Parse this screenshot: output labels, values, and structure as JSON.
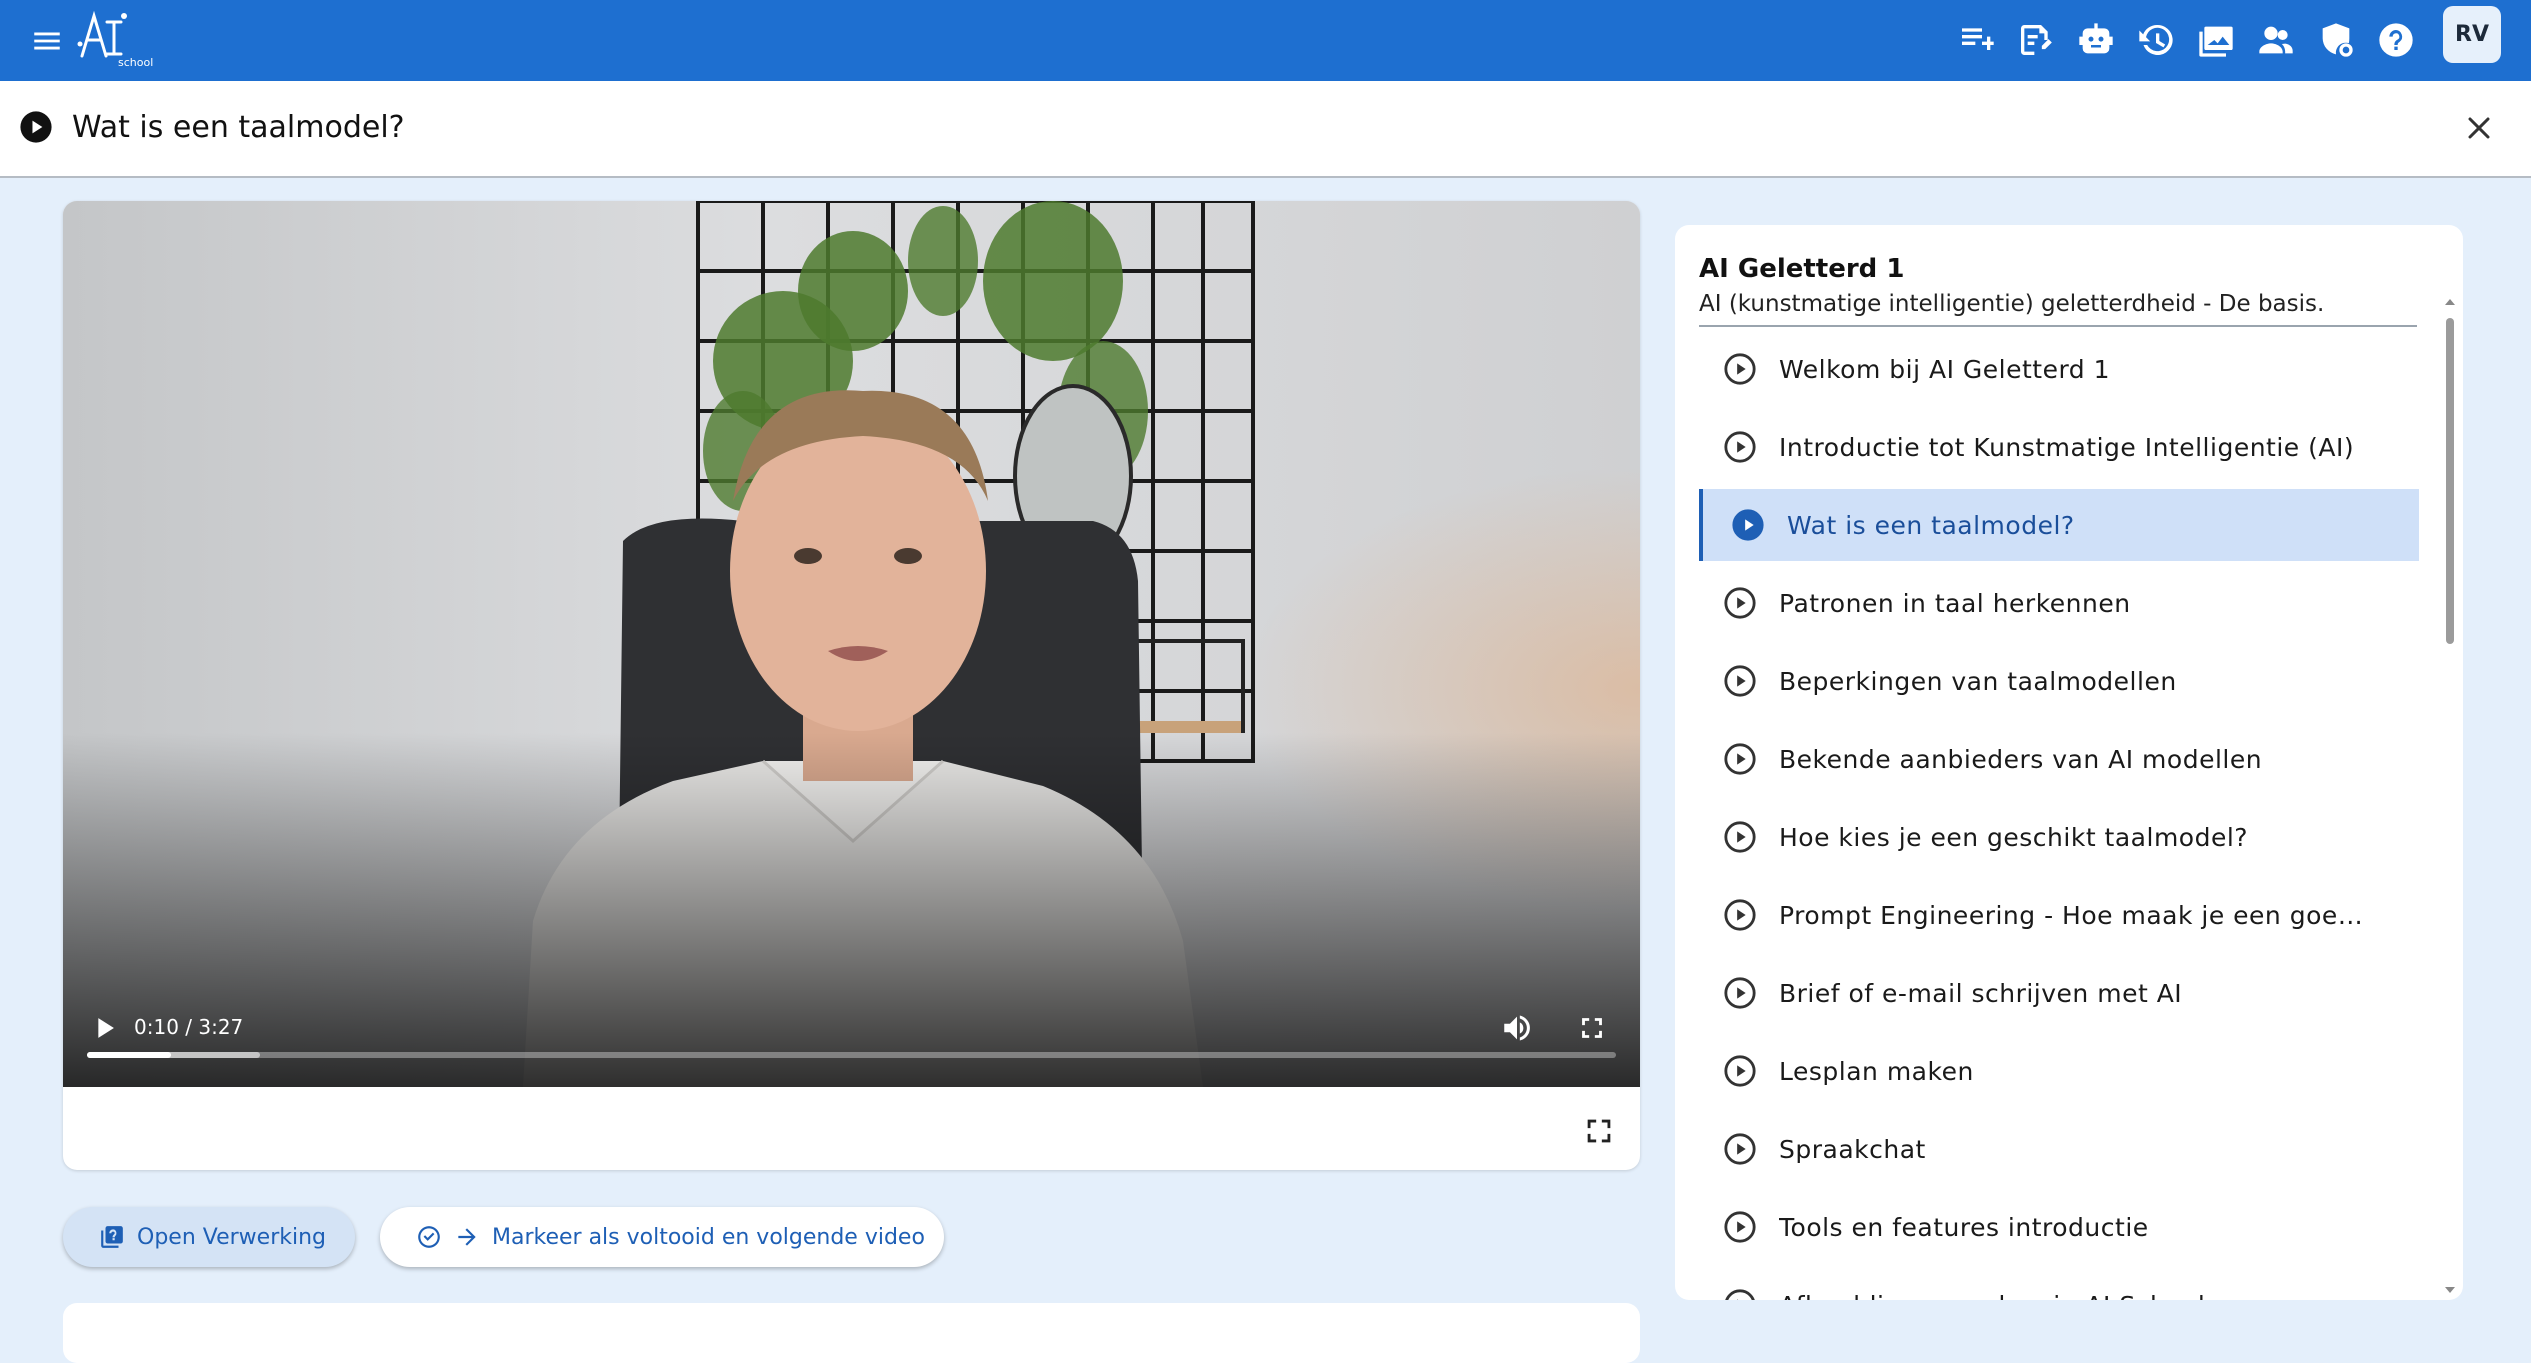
{
  "app": {
    "logo_text": "AI school",
    "avatar_initials": "RV",
    "toolbar_icons": [
      {
        "name": "playlist-add-icon"
      },
      {
        "name": "note-edit-icon"
      },
      {
        "name": "robot-icon"
      },
      {
        "name": "history-icon"
      },
      {
        "name": "image-gallery-icon"
      },
      {
        "name": "people-icon"
      },
      {
        "name": "shield-settings-icon"
      },
      {
        "name": "help-icon"
      }
    ],
    "header_color": "#1e6fd0"
  },
  "page": {
    "title": "Wat is een taalmodel?"
  },
  "video": {
    "time_display": "0:10 / 3:27",
    "progress_fraction": 0.055,
    "buffered_fraction": 0.113
  },
  "actions": {
    "open_label": "Open Verwerking",
    "mark_label": "Markeer als voltooid en volgende video"
  },
  "course": {
    "title": "AI Geletterd 1",
    "subtitle": "AI (kunstmatige intelligentie) geletterdheid - De basis.",
    "lessons": [
      {
        "label": "Welkom bij AI Geletterd 1",
        "active": false
      },
      {
        "label": "Introductie tot Kunstmatige Intelligentie (AI)",
        "active": false
      },
      {
        "label": "Wat is een taalmodel?",
        "active": true
      },
      {
        "label": "Patronen in taal herkennen",
        "active": false
      },
      {
        "label": "Beperkingen van taalmodellen",
        "active": false
      },
      {
        "label": "Bekende aanbieders van AI modellen",
        "active": false
      },
      {
        "label": "Hoe kies je een geschikt taalmodel?",
        "active": false
      },
      {
        "label": "Prompt Engineering - Hoe maak je een goede prompt?",
        "active": false
      },
      {
        "label": "Brief of e-mail schrijven met AI",
        "active": false
      },
      {
        "label": "Lesplan maken",
        "active": false
      },
      {
        "label": "Spraakchat",
        "active": false
      },
      {
        "label": "Tools en features introductie",
        "active": false
      },
      {
        "label": "Afbeeldingen maken in AI School",
        "active": false
      }
    ]
  }
}
